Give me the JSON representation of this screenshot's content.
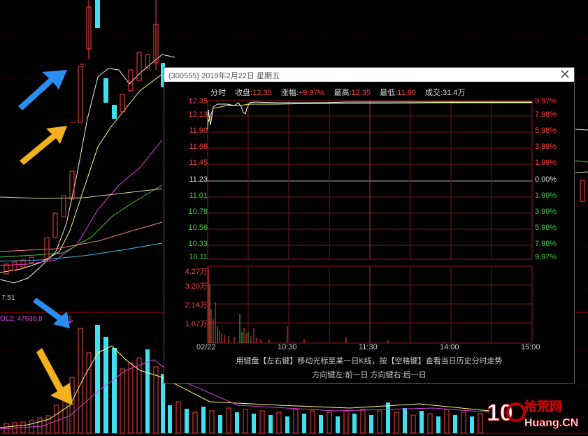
{
  "background_chart": {
    "price_label": "7.51",
    "volume_label": "OL2: 47936.8"
  },
  "popup": {
    "title": "(300555) 2019年2月22日 星期五",
    "info": {
      "tab": "分时",
      "close_label": "收盘:",
      "close_value": "12.35",
      "change_label": "涨幅:",
      "change_value": "+9.97%",
      "high_label": "最高:",
      "high_value": "12.35",
      "low_label": "最低:",
      "low_value": "11.90",
      "volume_label": "成交:",
      "volume_value": "31.4万"
    },
    "price_axis": [
      "12.35",
      "12.13",
      "11.90",
      "11.68",
      "11.45",
      "11.23",
      "11.01",
      "10.78",
      "10.56",
      "10.33",
      "10.11"
    ],
    "percent_axis": [
      "9.97%",
      "7.98%",
      "5.98%",
      "3.99%",
      "1.99%",
      "0.00%",
      "1.99%",
      "3.99%",
      "5.98%",
      "7.98%",
      "9.97%"
    ],
    "volume_axis": [
      "4.27万",
      "3.20万",
      "2.14万",
      "1.07万"
    ],
    "time_axis": [
      "02/22",
      "10:30",
      "11:30",
      "14:00",
      "15:00"
    ],
    "hint_line1": "用键盘【左右键】移动光标至某一日K线，按【空格键】查看当日历史分时走势",
    "hint_line2": "方向键左:前一日    方向键右:后一日",
    "colors": {
      "up": "#ff4040",
      "down": "#00ff00",
      "neutral": "#e0e0e0",
      "price_line": "#ffffff",
      "avg_line": "#ffff00",
      "grid": "#5a2020"
    }
  },
  "watermark": {
    "number": "10",
    "brand": "拾荒网",
    "domain": "Huang.CN"
  }
}
